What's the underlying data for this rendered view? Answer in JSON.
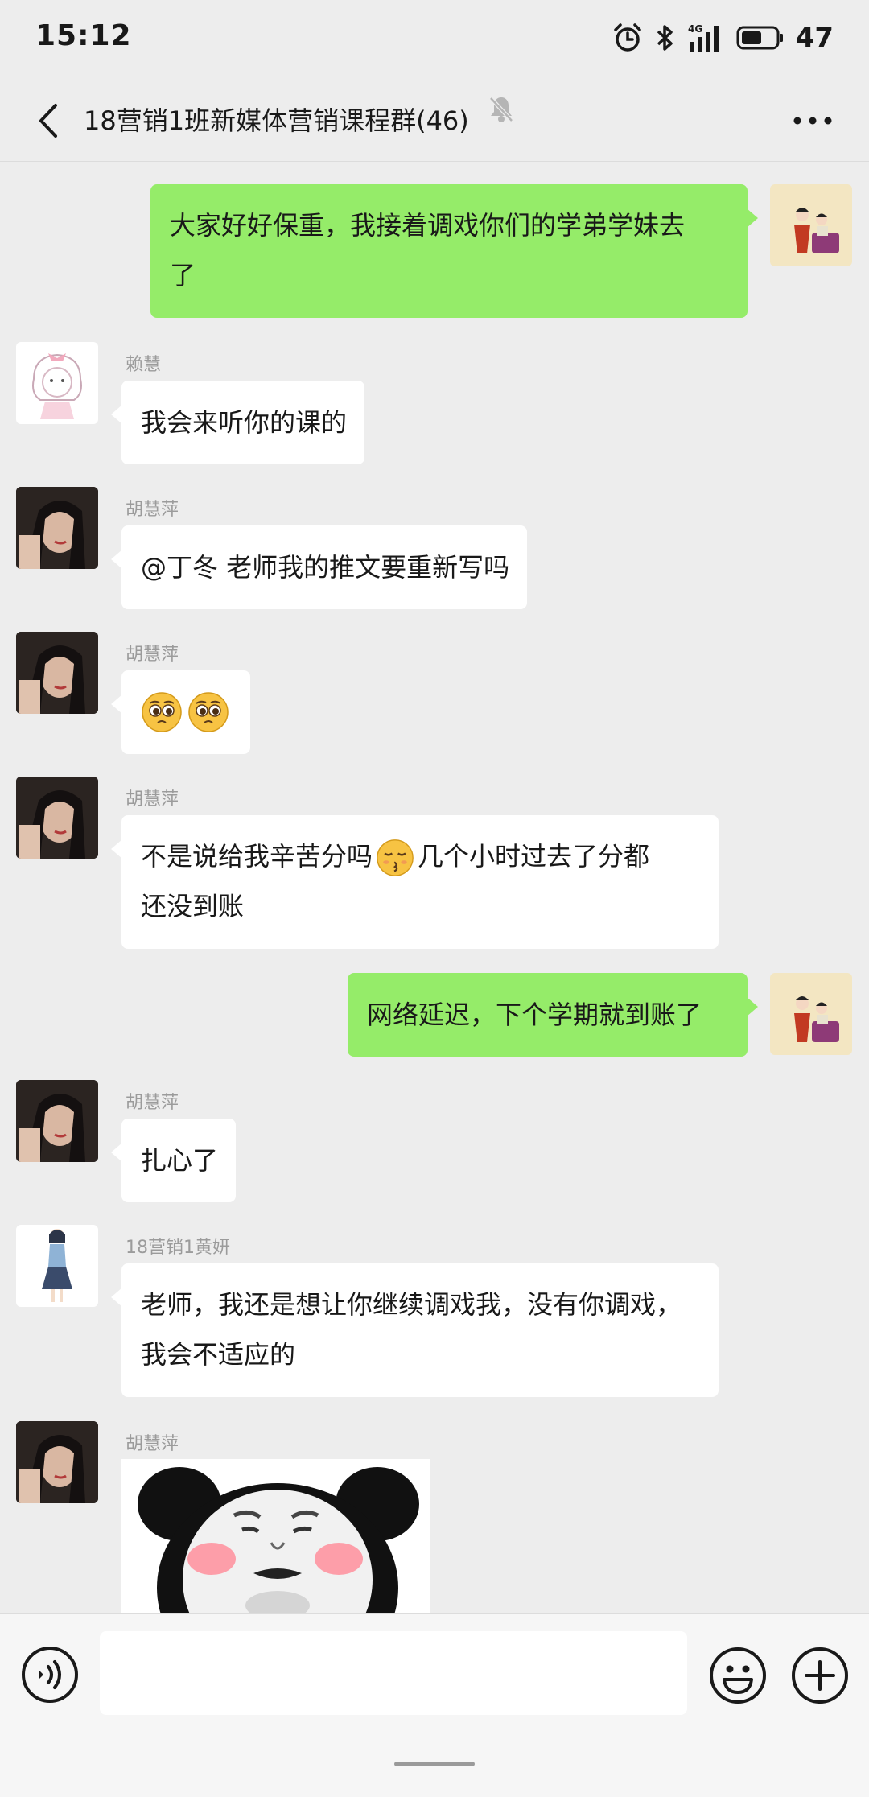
{
  "status_bar": {
    "time": "15:12",
    "network": "4G",
    "battery": "47"
  },
  "header": {
    "title": "18营销1班新媒体营销课程群(46)"
  },
  "messages": [
    {
      "lines": [
        "大家好好保重，我接着调戏你们的学弟学妹去",
        "了"
      ]
    },
    {
      "sender": "赖慧",
      "text": "我会来听你的课的"
    },
    {
      "sender": "胡慧萍",
      "text": "@丁冬  老师我的推文要重新写吗"
    },
    {
      "sender": "胡慧萍"
    },
    {
      "sender": "胡慧萍",
      "line1_a": "不是说给我辛苦分吗",
      "line1_b": "几个小时过去了分都",
      "line2": "还没到账"
    },
    {
      "text": "网络延迟，下个学期就到账了"
    },
    {
      "sender": "胡慧萍",
      "text": "扎心了"
    },
    {
      "sender": "18营销1黄妍",
      "lines": [
        "老师，我还是想让你继续调戏我，没有你调戏，",
        "我会不适应的"
      ]
    },
    {
      "sender": "胡慧萍"
    }
  ],
  "input": {
    "placeholder": ""
  }
}
